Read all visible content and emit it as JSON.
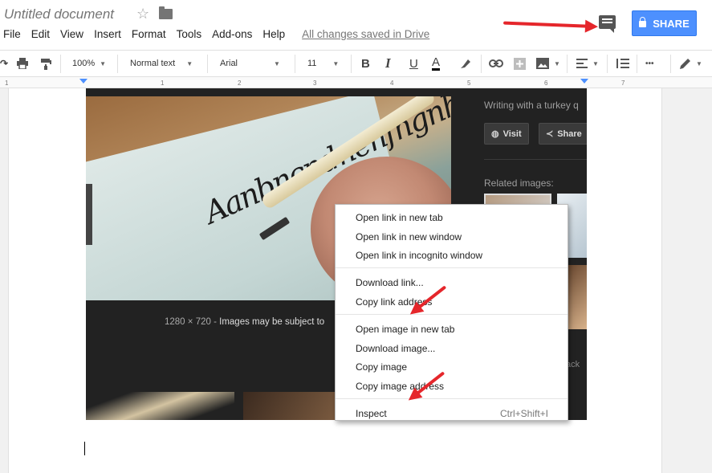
{
  "app": {
    "doc_title": "Untitled document",
    "menu": [
      "File",
      "Edit",
      "View",
      "Insert",
      "Format",
      "Tools",
      "Add-ons",
      "Help"
    ],
    "save_status": "All changes saved in Drive",
    "share_label": "SHARE"
  },
  "toolbar": {
    "zoom": "100%",
    "style": "Normal text",
    "font": "Arial",
    "size": "11",
    "bold": "B",
    "italic": "I",
    "underline": "U",
    "text_color": "A",
    "more": "•••"
  },
  "ruler": {
    "numbers": [
      "1",
      "1",
      "2",
      "3",
      "4",
      "5",
      "6",
      "7"
    ]
  },
  "pasted_screenshot": {
    "calligraphy_text": "Aanbncndnenfngnh",
    "panel_title": "Writing with a turkey q",
    "visit_label": "Visit",
    "share_label": "Share",
    "related_label": "Related images:",
    "caption_size": "1280 × 720",
    "caption_sep": "-",
    "caption_text": "Images may be subject to",
    "back_text": "ack"
  },
  "context_menu": {
    "items": [
      "Open link in new tab",
      "Open link in new window",
      "Open link in incognito window",
      "Download link...",
      "Copy link address",
      "Open image in new tab",
      "Download image...",
      "Copy image",
      "Copy image address",
      "Inspect"
    ],
    "inspect_shortcut": "Ctrl+Shift+I"
  },
  "colors": {
    "share_button": "#4d90fe",
    "annotation_arrows": "#e5262b",
    "text_color_underline": "#000000"
  }
}
